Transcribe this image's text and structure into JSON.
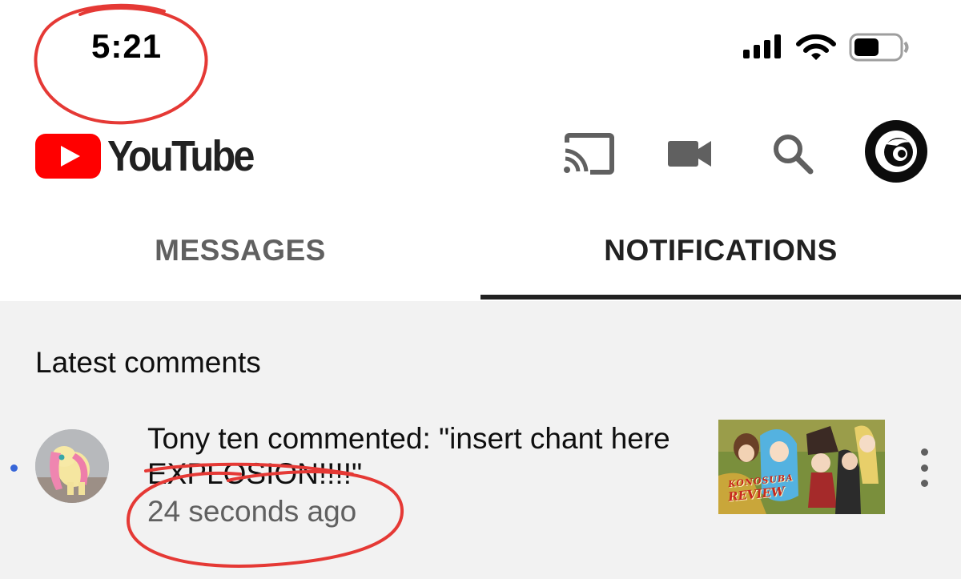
{
  "status_bar": {
    "time": "5:21",
    "icons": [
      "signal-icon",
      "wifi-icon",
      "battery-icon"
    ],
    "battery_level": 0.45
  },
  "app_bar": {
    "logo_text": "YouTube",
    "icons": [
      "cast-icon",
      "camera-icon",
      "search-icon",
      "account-avatar"
    ],
    "brand_color": "#ff0000"
  },
  "tabs": [
    {
      "label": "MESSAGES",
      "active": false
    },
    {
      "label": "NOTIFICATIONS",
      "active": true
    }
  ],
  "content": {
    "section_title": "Latest comments",
    "notifications": [
      {
        "text": "Tony ten commented: \"insert chant here EXPLOSION!!!!\"",
        "time": "24 seconds ago",
        "unread": true,
        "thumbnail_label_top": "KONOSUBA",
        "thumbnail_label_bottom": "REVIEW"
      }
    ]
  },
  "annotation_color": "#e53935"
}
